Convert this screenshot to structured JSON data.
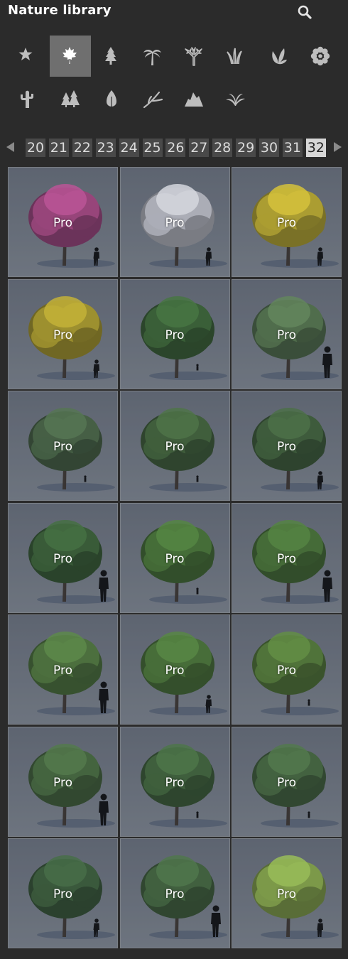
{
  "header": {
    "title": "Nature library",
    "search_icon": "search-icon"
  },
  "categories": [
    {
      "name": "favorites",
      "icon": "star-icon",
      "active": false
    },
    {
      "name": "broadleaf",
      "icon": "maple-leaf-icon",
      "active": true
    },
    {
      "name": "conifer",
      "icon": "conifer-tree-icon",
      "active": false
    },
    {
      "name": "palm",
      "icon": "palm-tree-icon",
      "active": false
    },
    {
      "name": "bare-tree",
      "icon": "bare-tree-icon",
      "active": false
    },
    {
      "name": "grass",
      "icon": "grass-icon",
      "active": false
    },
    {
      "name": "plant",
      "icon": "plant-leaves-icon",
      "active": false
    },
    {
      "name": "flower",
      "icon": "flower-icon",
      "active": false
    },
    {
      "name": "cactus",
      "icon": "cactus-icon",
      "active": false
    },
    {
      "name": "forest",
      "icon": "forest-icon",
      "active": false
    },
    {
      "name": "leaf",
      "icon": "leaf-icon",
      "active": false
    },
    {
      "name": "branch",
      "icon": "branch-icon",
      "active": false
    },
    {
      "name": "rocks",
      "icon": "rocks-icon",
      "active": false
    },
    {
      "name": "fern",
      "icon": "fern-icon",
      "active": false
    }
  ],
  "pagination": {
    "pages": [
      "20",
      "21",
      "22",
      "23",
      "24",
      "25",
      "26",
      "27",
      "28",
      "29",
      "30",
      "31",
      "32"
    ],
    "current": "32"
  },
  "tiles": [
    {
      "label": "Pro",
      "foliage": "#b04a86",
      "person": "right-small"
    },
    {
      "label": "Pro",
      "foliage": "#c9c9cf",
      "person": "right-small"
    },
    {
      "label": "Pro",
      "foliage": "#c9b52e",
      "person": "right-small"
    },
    {
      "label": "Pro",
      "foliage": "#b8a52a",
      "person": "right-small"
    },
    {
      "label": "Pro",
      "foliage": "#3f6a35",
      "person": "tiny"
    },
    {
      "label": "Pro",
      "foliage": "#5a7a4e",
      "person": "right-large"
    },
    {
      "label": "Pro",
      "foliage": "#4d6a45",
      "person": "tiny"
    },
    {
      "label": "Pro",
      "foliage": "#46683a",
      "person": "tiny"
    },
    {
      "label": "Pro",
      "foliage": "#44653a",
      "person": "right-small"
    },
    {
      "label": "Pro",
      "foliage": "#3d6535",
      "person": "right-large"
    },
    {
      "label": "Pro",
      "foliage": "#4c7a35",
      "person": "tiny"
    },
    {
      "label": "Pro",
      "foliage": "#4c7835",
      "person": "right-large"
    },
    {
      "label": "Pro",
      "foliage": "#557d3c",
      "person": "right-large"
    },
    {
      "label": "Pro",
      "foliage": "#4f7b36",
      "person": "right-small"
    },
    {
      "label": "Pro",
      "foliage": "#5a8237",
      "person": "tiny"
    },
    {
      "label": "Pro",
      "foliage": "#4b6f3e",
      "person": "right-large"
    },
    {
      "label": "Pro",
      "foliage": "#456a3b",
      "person": "tiny"
    },
    {
      "label": "Pro",
      "foliage": "#4a6d3f",
      "person": "tiny"
    },
    {
      "label": "Pro",
      "foliage": "#3f623a",
      "person": "right-small"
    },
    {
      "label": "Pro",
      "foliage": "#476b3e",
      "person": "right-large"
    },
    {
      "label": "Pro",
      "foliage": "#8fb04a",
      "person": "right-small"
    }
  ]
}
